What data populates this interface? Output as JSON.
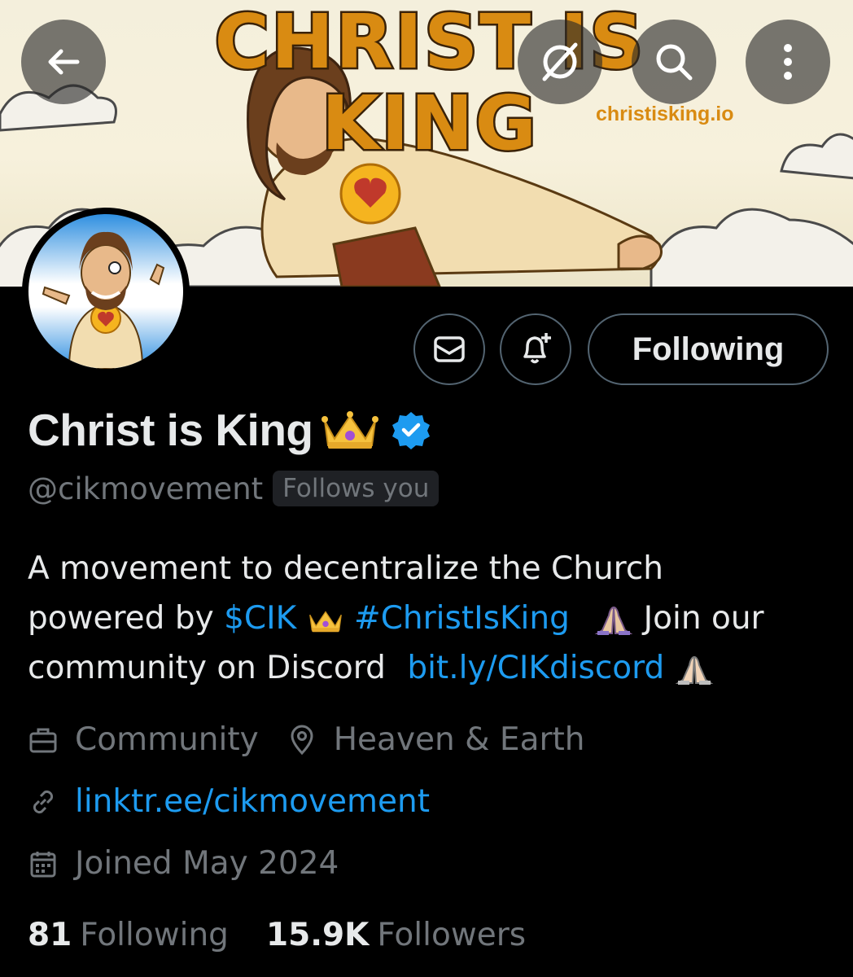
{
  "banner": {
    "title": "CHRIST IS KING",
    "url_text": "christisking.io"
  },
  "top_bar": {
    "back_icon": "arrow-left-icon",
    "grok_icon": "grok-icon",
    "search_icon": "search-icon",
    "more_icon": "more-vertical-icon"
  },
  "actions": {
    "message_icon": "envelope-icon",
    "notify_icon": "bell-plus-icon",
    "follow_label": "Following"
  },
  "profile": {
    "name": "Christ is King",
    "handle": "@cikmovement",
    "follows_you": "Follows you",
    "verified": true
  },
  "bio": {
    "line1": "A movement to decentralize the Church",
    "line2_prefix": "powered by ",
    "cashtag": "$CIK",
    "hashtag": "#ChristIsKing",
    "line2_suffix": "Join our",
    "line3_prefix": "community on Discord",
    "discord_link": "bit.ly/CIKdiscord"
  },
  "meta": {
    "category": "Community",
    "location": "Heaven & Earth",
    "website": "linktr.ee/cikmovement",
    "joined": "Joined May 2024"
  },
  "stats": {
    "following_count": "81",
    "following_label": "Following",
    "followers_count": "15.9K",
    "followers_label": "Followers"
  },
  "colors": {
    "accent": "#1d9bf0",
    "secondary_text": "#71767b",
    "primary_text": "#e7e9ea",
    "background": "#000000"
  }
}
